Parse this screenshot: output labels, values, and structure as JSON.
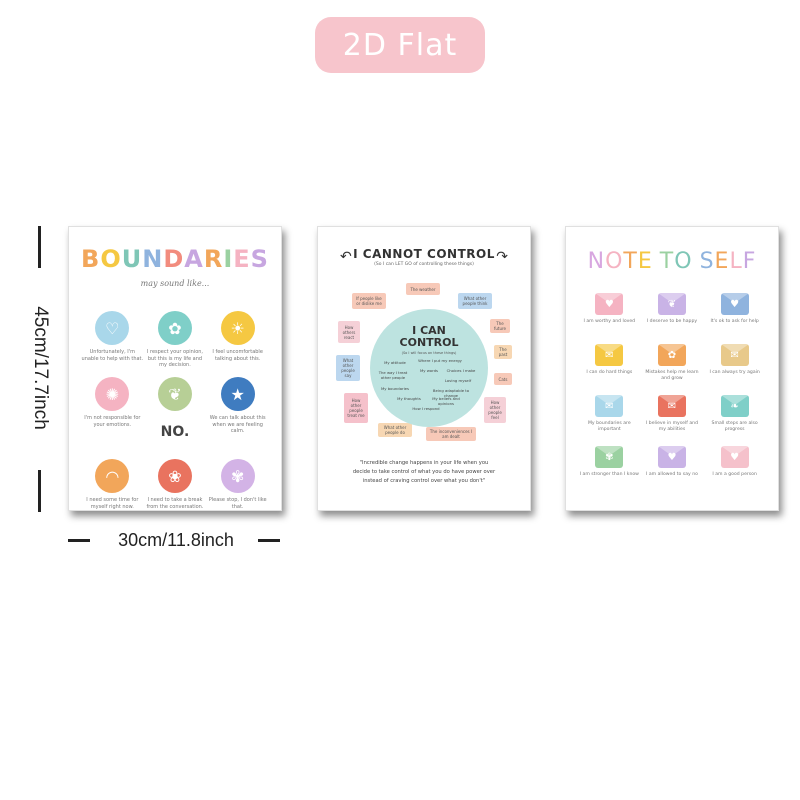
{
  "badge": {
    "label": "2D Flat",
    "color": "#f7c5cc"
  },
  "dimensions": {
    "height_label": "45cm/17.7inch",
    "width_label": "30cm/11.8inch"
  },
  "boundaries": {
    "title_letters": [
      "B",
      "O",
      "U",
      "N",
      "D",
      "A",
      "R",
      "I",
      "E",
      "S"
    ],
    "title_colors": [
      "#f2a65a",
      "#f5c842",
      "#7fc6b6",
      "#8fb3de",
      "#f28c7e",
      "#c7a6e0",
      "#f2a65a",
      "#9bd1a1",
      "#f5b3c2",
      "#c7a6e0"
    ],
    "subtitle": "may sound like...",
    "items": [
      {
        "icon": "heart-icon",
        "glyph": "♡",
        "color": "#a9d7ea",
        "text": "Unfortunately, I'm unable to help with that."
      },
      {
        "icon": "flower-icon",
        "glyph": "✿",
        "color": "#7fcfc8",
        "text": "I respect your opinion, but this is my life and my decision."
      },
      {
        "icon": "sun-icon",
        "glyph": "☀",
        "color": "#f5c842",
        "text": "I feel uncomfortable talking about this."
      },
      {
        "icon": "burst-icon",
        "glyph": "✺",
        "color": "#f5b3c2",
        "text": "I'm not responsible for your emotions."
      },
      {
        "icon": "leaf-icon",
        "glyph": "❦",
        "color": "#b7cf96",
        "text": "NO."
      },
      {
        "icon": "star-icon",
        "glyph": "★",
        "color": "#3f7cc0",
        "text": "We can talk about this when we are feeling calm."
      },
      {
        "icon": "rainbow-icon",
        "glyph": "◠",
        "color": "#f2a65a",
        "text": "I need some time for myself right now."
      },
      {
        "icon": "butterfly-icon",
        "glyph": "❀",
        "color": "#e9735f",
        "text": "I need to take a break from the conversation."
      },
      {
        "icon": "blossom-icon",
        "glyph": "✾",
        "color": "#d3b3e6",
        "text": "Please stop, I don't like that."
      }
    ]
  },
  "control": {
    "title": "I CANNOT CONTROL",
    "subtitle": "(So I can LET GO of controlling these things)",
    "outer": [
      "The weather",
      "If people like or dislike me",
      "What other people think",
      "How others react",
      "The future",
      "The past",
      "What other people say",
      "Cats",
      "How other people treat me",
      "How other people feel",
      "What other people do",
      "The inconveniences I am dealt"
    ],
    "outer_colors": [
      "#f7c9b8",
      "#f7c9b8",
      "#bcd7ef",
      "#f5d0d7",
      "#f7c9b8",
      "#f7d7b3",
      "#bcd7ef",
      "#f7c9b8",
      "#f5c1cb",
      "#f5d0d7",
      "#f7d7b3",
      "#f7c9b8"
    ],
    "inner_title_1": "I CAN",
    "inner_title_2": "CONTROL",
    "inner_subtitle": "(So I will focus on these things)",
    "inner": [
      "My attitude",
      "Where I put my energy",
      "My words",
      "Choices I make",
      "The way I treat other people",
      "Loving myself",
      "My boundaries",
      "Being adaptable to change",
      "My thoughts",
      "My beliefs and opinions",
      "How I respond"
    ],
    "quote": "\"Incredible change happens in your life when you decide to take control of what you do have power over instead of craving control over what you don't\""
  },
  "note": {
    "title_letters": [
      "N",
      "O",
      "T",
      "E",
      " ",
      "T",
      "O",
      " ",
      "S",
      "E",
      "L",
      "F"
    ],
    "title_colors": [
      "#d8a7e0",
      "#f5b3c2",
      "#f2a65a",
      "#f5c842",
      "#ffffff",
      "#9bd1a1",
      "#7fc6b6",
      "#ffffff",
      "#8fb3de",
      "#f2a65a",
      "#f5b3c2",
      "#c7a6e0"
    ],
    "items": [
      {
        "icon": "envelope-heart-icon",
        "glyph": "♥",
        "color": "#f5b3c2",
        "text": "I am worthy and loved"
      },
      {
        "icon": "envelope-leaf-icon",
        "glyph": "❦",
        "color": "#c9b3e6",
        "text": "I deserve to be happy"
      },
      {
        "icon": "envelope-blue-icon",
        "glyph": "♥",
        "color": "#8fb3de",
        "text": "It's ok to ask for help"
      },
      {
        "icon": "envelope-yellow-icon",
        "glyph": "✉",
        "color": "#f5c842",
        "text": "I can do hard things"
      },
      {
        "icon": "envelope-flower-icon",
        "glyph": "✿",
        "color": "#f2a65a",
        "text": "Mistakes help me learn and grow"
      },
      {
        "icon": "envelope-sand-icon",
        "glyph": "✉",
        "color": "#e8c98a",
        "text": "I can always try again"
      },
      {
        "icon": "envelope-sky-icon",
        "glyph": "✉",
        "color": "#a9d7ea",
        "text": "My boundaries are important"
      },
      {
        "icon": "envelope-red-icon",
        "glyph": "✉",
        "color": "#e9735f",
        "text": "I believe in myself and my abilities"
      },
      {
        "icon": "envelope-teal-icon",
        "glyph": "❧",
        "color": "#7fcfc8",
        "text": "Small steps are also progress"
      },
      {
        "icon": "envelope-bouquet-icon",
        "glyph": "✾",
        "color": "#9bd1a1",
        "text": "I am stronger than I know"
      },
      {
        "icon": "envelope-lilac-icon",
        "glyph": "♥",
        "color": "#c9b3e6",
        "text": "I am allowed to say no"
      },
      {
        "icon": "envelope-pink-icon",
        "glyph": "♥",
        "color": "#f5c1cb",
        "text": "I am a good person"
      }
    ]
  }
}
